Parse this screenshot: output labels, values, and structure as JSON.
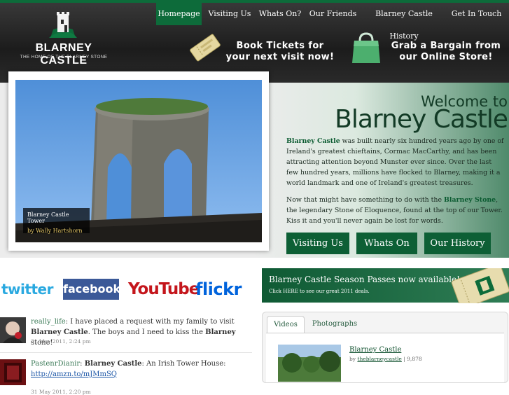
{
  "logo": {
    "name": "BLARNEY CASTLE",
    "tagline": "THE HOME OF THE BLARNEY STONE"
  },
  "nav": [
    "Homepage",
    "Visiting Us",
    "Whats On?",
    "Our Friends",
    "Blarney Castle History",
    "Get In Touch"
  ],
  "promos": {
    "tickets": [
      "Book Tickets for",
      "your next visit now!"
    ],
    "store": [
      "Grab a Bargain from",
      "our Online Store!"
    ]
  },
  "photo": {
    "caption_title": "Blarney Castle Tower",
    "caption_by": "by Wally Hartshorn"
  },
  "welcome": {
    "subtitle": "Welcome to",
    "title": "Blarney Castle",
    "para1_strong": "Blarney Castle",
    "para1_rest": " was built nearly six hundred years ago by one of Ireland's greatest chieftains, Cormac MacCarthy, and has been attracting attention beyond Munster ever since. Over the last few hundred years, millions have flocked to Blarney, making it a world landmark and one of Ireland's greatest treasures.",
    "para2_start": "Now that might have something to do with the ",
    "para2_strong": "Blarney Stone",
    "para2_rest": ", the legendary Stone of Eloquence, found at the top of our Tower. Kiss it and you'll never again be lost for words."
  },
  "buttons": [
    "Visiting Us",
    "Whats On",
    "Our History"
  ],
  "social": [
    "twitter",
    "facebook",
    "YouTube",
    "flickr"
  ],
  "season_pass": {
    "title": "Blarney Castle Season Passes now available!",
    "sub": "Click HERE to see our great 2011 deals."
  },
  "feed": [
    {
      "user": "really_life",
      "parts": [
        ": I have placed a request with my family to visit ",
        "Blarney Castle",
        ". The boys and I need to kiss the ",
        "Blarney",
        " stone!"
      ],
      "time": "31 May 2011, 2:24 pm"
    },
    {
      "user": "PastenrDianir",
      "parts": [
        ": ",
        "Blarney Castle",
        ": An Irish Tower House:"
      ],
      "link": "http://amzn.to/mJMmSQ",
      "time": "31 May 2011, 2:20 pm"
    }
  ],
  "media_tabs": [
    "Videos",
    "Photographs"
  ],
  "video": {
    "title": "Blarney Castle",
    "by_label": "by",
    "channel": "theblarneycastle",
    "views": "9,878"
  },
  "colors": {
    "brand_green": "#0d6b3a",
    "dark_green": "#0d5f35",
    "header_dark": "#1c1c1c"
  }
}
